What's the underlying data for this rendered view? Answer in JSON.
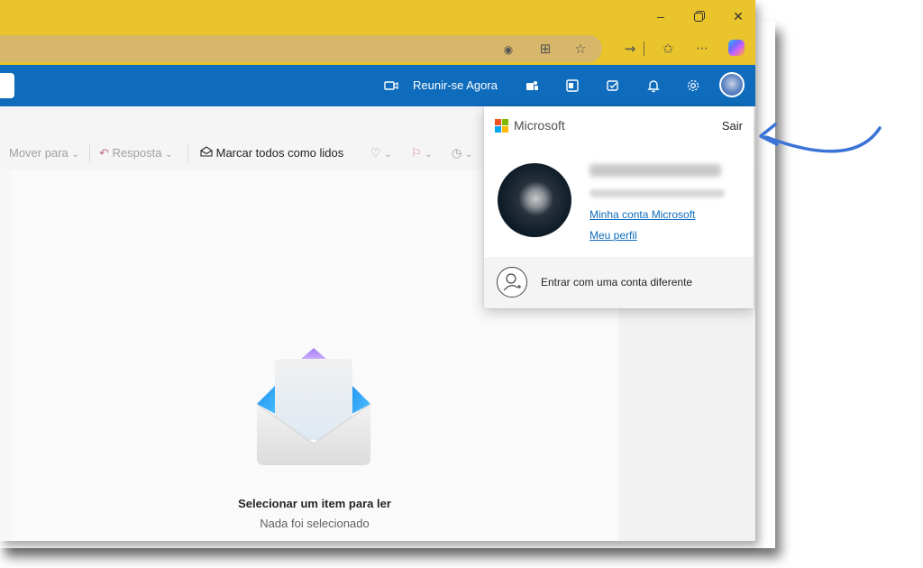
{
  "header": {
    "meet_now_label": "Reunir-se Agora"
  },
  "toolbar": {
    "move_to_label": "Mover para",
    "reply_label": "Resposta",
    "mark_all_read_label": "Marcar todos como lidos"
  },
  "reading_pane": {
    "empty_title": "Selecionar um item para ler",
    "empty_subtitle": "Nada foi selecionado"
  },
  "account_popup": {
    "brand": "Microsoft",
    "sign_out_label": "Sair",
    "my_account_link": "Minha conta Microsoft",
    "my_profile_link": "Meu perfil",
    "switch_account_label": "Entrar com uma conta diferente"
  },
  "colors": {
    "titlebar": "#e9c42a",
    "outlook_header": "#0f6cbd",
    "link": "#0f6cbd",
    "annotation_arrow": "#3b73d6"
  },
  "icons": [
    "minimize-icon",
    "restore-icon",
    "close-icon",
    "reading-view-icon",
    "split-screen-icon",
    "favorite-star-icon",
    "extensions-icon",
    "favorites-icon",
    "more-icon",
    "copilot-icon",
    "video-camera-icon",
    "teams-icon",
    "onenote-icon",
    "todo-icon",
    "bell-icon",
    "settings-gear-icon",
    "tag-icon",
    "flag-icon",
    "clock-icon",
    "envelope-illustration",
    "person-add-icon"
  ]
}
